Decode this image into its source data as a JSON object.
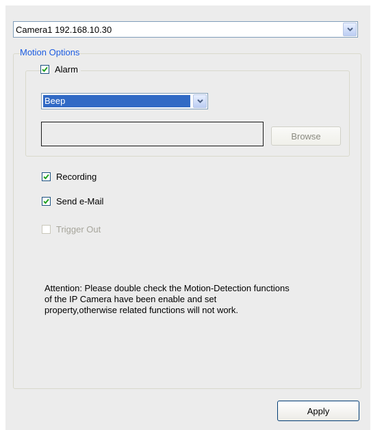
{
  "camera_select": {
    "value": "Camera1 192.168.10.30",
    "icon": "chevron-down-icon"
  },
  "motion_options": {
    "legend": "Motion Options",
    "alarm": {
      "label": "Alarm",
      "checked": true,
      "sound_select": {
        "value": "Beep",
        "icon": "chevron-down-icon"
      },
      "file_path": "",
      "browse_label": "Browse"
    },
    "recording": {
      "label": "Recording",
      "checked": true
    },
    "send_email": {
      "label": "Send e-Mail",
      "checked": true
    },
    "trigger_out": {
      "label": "Trigger Out",
      "checked": false,
      "disabled": true
    },
    "attention_text": "Attention: Please double check the Motion-Detection functions of the IP Camera have been enable and set property,otherwise related functions will not work."
  },
  "apply_label": "Apply",
  "colors": {
    "legend": "#1c5ce0",
    "checkmark": "#21a121",
    "selection": "#316ac5",
    "panel": "#ececec"
  }
}
